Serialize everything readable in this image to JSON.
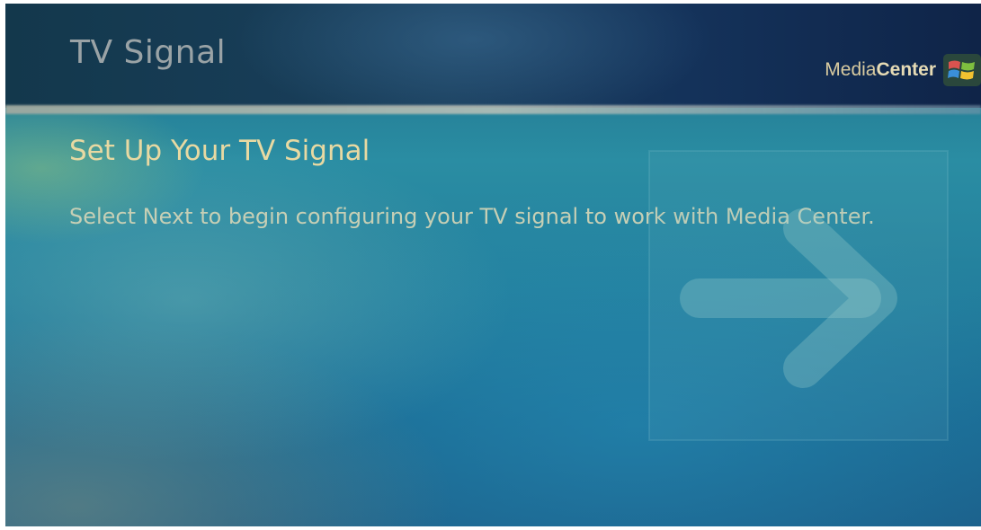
{
  "header": {
    "title": "TV Signal",
    "brand_regular": "Media",
    "brand_bold": "Center",
    "logo_icon": "windows-flag-icon"
  },
  "main": {
    "heading": "Set Up Your TV Signal",
    "instruction": "Select Next to begin configuring your TV signal to work with Media Center.",
    "background_icon": "arrow-right-icon"
  },
  "colors": {
    "title": "#9aa3a6",
    "heading": "#e8d9a2",
    "body_text": "#c6cfb5",
    "header_bg": "#163a55",
    "content_bg": "#2a8da3"
  }
}
